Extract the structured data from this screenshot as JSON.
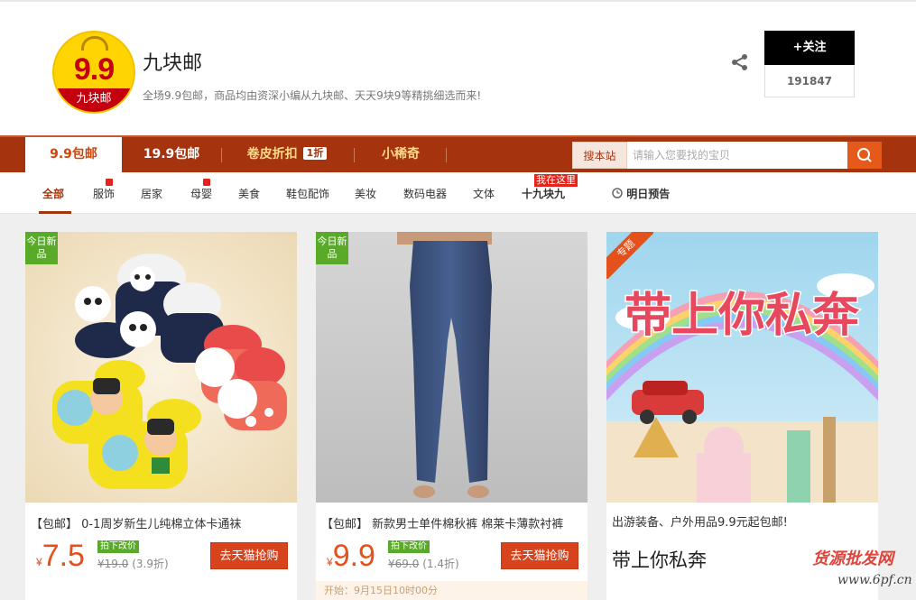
{
  "shop": {
    "logo_number": "9.9",
    "logo_text": "九块邮",
    "name": "九块邮",
    "description": "全场9.9包邮，商品均由资深小编从九块邮、天天9块9等精挑细选而来!",
    "follow_label": "+关注",
    "follower_count": "191847"
  },
  "nav": {
    "tabs": [
      {
        "label": "9.9包邮"
      },
      {
        "label": "19.9包邮"
      },
      {
        "label": "卷皮折扣",
        "badge": "1折"
      },
      {
        "label": "小稀奇"
      }
    ],
    "search_label": "搜本站",
    "search_placeholder": "请输入您要找的宝贝"
  },
  "categories": {
    "items": [
      "全部",
      "服饰",
      "居家",
      "母婴",
      "美食",
      "鞋包配饰",
      "美妆",
      "数码电器",
      "文体",
      "十九块九",
      "明日预告"
    ],
    "hint": "我在这里"
  },
  "products": [
    {
      "tag": "今日新品",
      "title": "【包邮】 0-1周岁新生儿纯棉立体卡通袜",
      "yen": "¥",
      "price": "7.5",
      "price_badge": "拍下改价",
      "original": "¥19.0",
      "discount": "(3.9折)",
      "button": "去天猫抢购"
    },
    {
      "tag": "今日新品",
      "title": "【包邮】 新款男士单件棉秋裤 棉莱卡薄款衬裤",
      "yen": "¥",
      "price": "9.9",
      "price_badge": "拍下改价",
      "original": "¥69.0",
      "discount": "(1.4折)",
      "button": "去天猫抢购",
      "start_time": "开始：9月15日10时00分"
    }
  ],
  "promo": {
    "tag": "专题",
    "banner_text": "带上你私奔",
    "description": "出游装备、户外用品9.9元起包邮!",
    "title": "带上你私奔"
  },
  "watermark": {
    "line1": "货源批发网",
    "line2": "www.6pf.cn"
  },
  "colors": {
    "nav_bg": "#a4330e",
    "accent": "#e5511b",
    "new_tag": "#5aaa2a"
  }
}
